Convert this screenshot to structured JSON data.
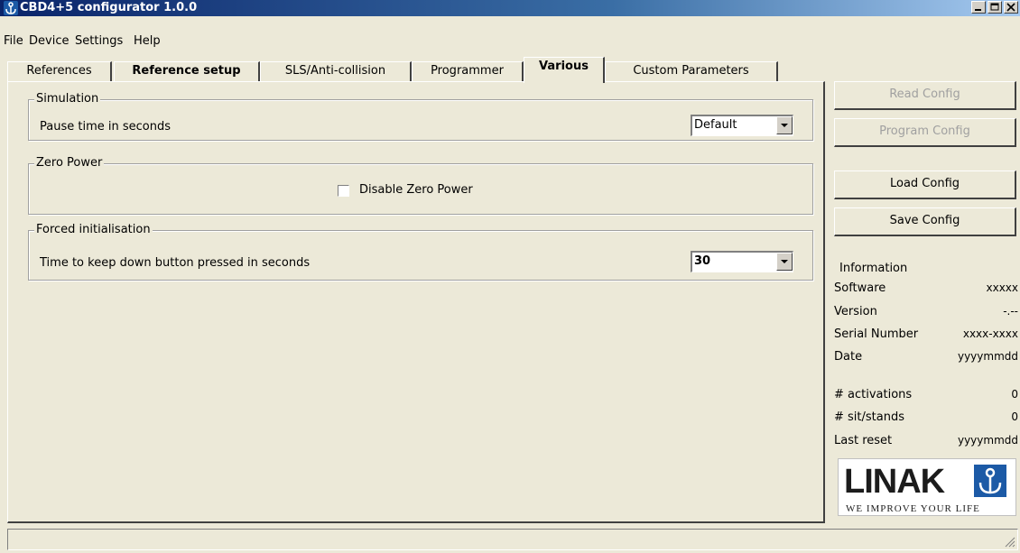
{
  "window": {
    "title": "CBD4+5 configurator 1.0.0"
  },
  "menu": [
    "File",
    "Device",
    "Settings",
    "Help"
  ],
  "tabs": [
    "References",
    "Reference setup",
    "SLS/Anti-collision",
    "Programmer",
    "Various",
    "Custom Parameters"
  ],
  "active_tab": "Various",
  "simulation": {
    "legend": "Simulation",
    "label": "Pause time in seconds",
    "value": "Default"
  },
  "zero_power": {
    "legend": "Zero Power",
    "checkbox_label": "Disable Zero Power",
    "checked": false
  },
  "forced_init": {
    "legend": "Forced initialisation",
    "label": "Time to keep down button pressed in seconds",
    "value": "30"
  },
  "buttons": {
    "read_config": "Read Config",
    "program_config": "Program Config",
    "load_config": "Load Config",
    "save_config": "Save Config"
  },
  "info": {
    "legend": "Information",
    "rows": [
      {
        "key": "Software",
        "value": "xxxxx"
      },
      {
        "key": "Version",
        "value": "-.--"
      },
      {
        "key": "Serial Number",
        "value": "xxxx-xxxx"
      },
      {
        "key": "Date",
        "value": "yyyymmdd"
      },
      {
        "key": "# activations",
        "value": "0"
      },
      {
        "key": "# sit/stands",
        "value": "0"
      },
      {
        "key": "Last reset",
        "value": "yyyymmdd"
      }
    ]
  },
  "logo": {
    "brand": "LINAK",
    "tagline": "WE IMPROVE YOUR LIFE",
    "color": "#1c5aa6"
  }
}
